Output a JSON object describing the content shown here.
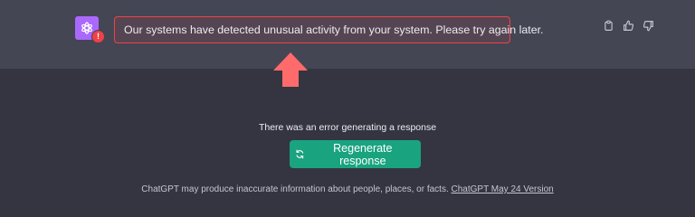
{
  "message": {
    "avatar_icon": "openai-logo-icon",
    "badge_text": "!",
    "error_text": "Our systems have detected unusual activity from your system. Please try again later."
  },
  "actions": [
    {
      "name": "copy-icon"
    },
    {
      "name": "thumbs-up-icon"
    },
    {
      "name": "thumbs-down-icon"
    }
  ],
  "status": {
    "error_message": "There was an error generating a response",
    "regenerate_label": "Regenerate response"
  },
  "footer": {
    "disclaimer": "ChatGPT may produce inaccurate information about people, places, or facts.",
    "version_link": "ChatGPT May 24 Version"
  },
  "colors": {
    "background": "#343541",
    "message_row": "#444654",
    "accent": "#19a37f",
    "error": "#ef4146",
    "avatar": "#ab68ff",
    "arrow": "#ff6b6b"
  }
}
